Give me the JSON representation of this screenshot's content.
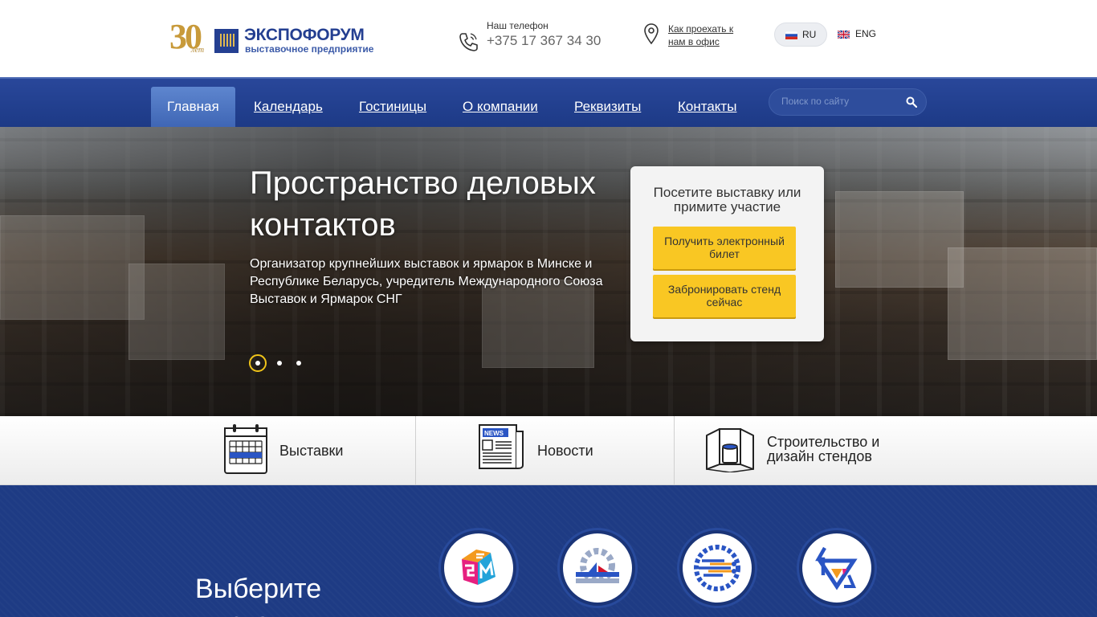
{
  "header": {
    "logo": {
      "anniversary_number": "30",
      "anniversary_word": "лет",
      "name": "ЭКСПОФОРУМ",
      "subtitle": "выставочное предприятие"
    },
    "phone_label": "Наш телефон",
    "phone_number": "+375 17 367 34 30",
    "directions_link": "Как проехать к нам в офис",
    "languages": [
      {
        "code": "RU",
        "active": true
      },
      {
        "code": "ENG",
        "active": false
      }
    ]
  },
  "nav": {
    "items": [
      {
        "label": "Главная",
        "active": true
      },
      {
        "label": "Календарь"
      },
      {
        "label": "Гостиницы"
      },
      {
        "label": "О компании"
      },
      {
        "label": "Реквизиты"
      },
      {
        "label": "Контакты"
      }
    ],
    "search_placeholder": "Поиск по сайту"
  },
  "hero": {
    "title": "Пространство деловых контактов",
    "description": "Организатор крупнейших выставок и ярмарок в Минске и Республике Беларусь, учредитель Международного Союза Выставок и Ярмарок СНГ",
    "slides_count": 3,
    "active_slide": 1,
    "cta": {
      "title": "Посетите выставку или примите участие",
      "buttons": [
        {
          "label": "Получить электронный билет"
        },
        {
          "label": "Забронировать стенд сейчас"
        }
      ]
    }
  },
  "features": [
    {
      "label": "Выставки",
      "icon": "calendar-icon"
    },
    {
      "label": "Новости",
      "icon": "newspaper-icon"
    },
    {
      "label": "Строительство и дизайн стендов",
      "icon": "stand-booth-icon"
    }
  ],
  "expo_section": {
    "title": "Выберите выставку",
    "badges": [
      "gem-logo-icon",
      "gear-machine-logo-icon",
      "tech-circuit-logo-icon",
      "arrows-triangle-logo-icon"
    ]
  },
  "colors": {
    "brand_blue": "#1e3e8e",
    "gold": "#c89a3a",
    "cta_yellow": "#f9c723",
    "active_dot": "#f0c419"
  }
}
